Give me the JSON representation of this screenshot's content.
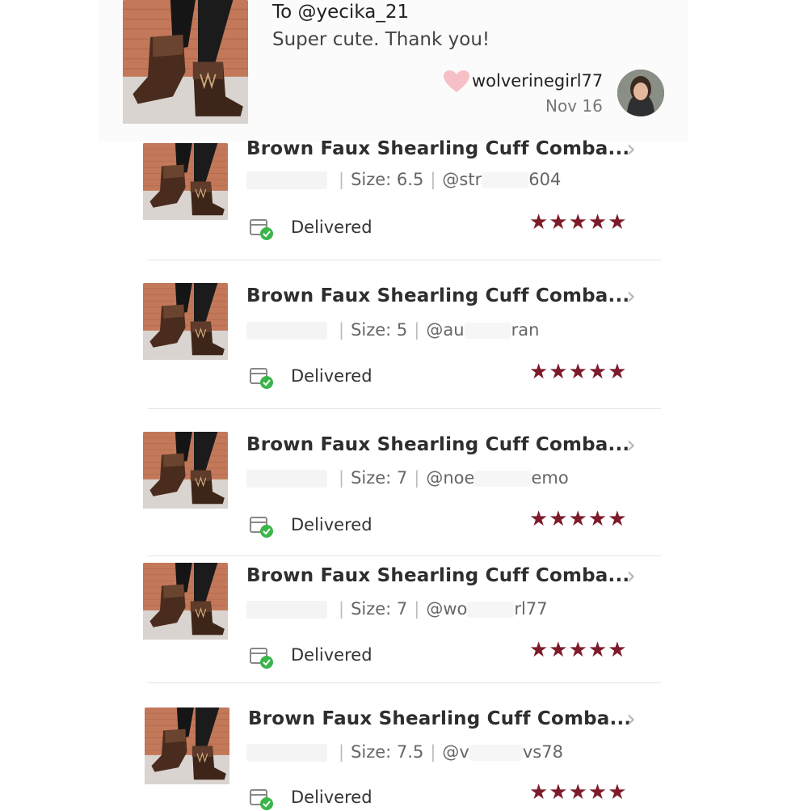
{
  "review": {
    "to": "To @yecika_21",
    "message": "Super cute. Thank you!",
    "reviewer": "wolverinegirl77",
    "date": "Nov 16"
  },
  "orders": [
    {
      "title": "Brown Faux Shearling Cuff Comba...",
      "size": "Size: 6.5",
      "handle_start": "@str",
      "handle_end": "604",
      "status": "Delivered",
      "stars": "★★★★★",
      "rating": 5
    },
    {
      "title": "Brown Faux Shearling Cuff Comba...",
      "size": "Size: 5",
      "handle_start": "@au",
      "handle_end": "ran",
      "status": "Delivered",
      "stars": "★★★★★",
      "rating": 5
    },
    {
      "title": "Brown Faux Shearling Cuff Comba...",
      "size": "Size: 7",
      "handle_start": "@noe",
      "handle_end": "emo",
      "status": "Delivered",
      "stars": "★★★★★",
      "rating": 5
    },
    {
      "title": "Brown Faux Shearling Cuff Comba...",
      "size": "Size: 7",
      "handle_start": "@wo",
      "handle_end": "rl77",
      "status": "Delivered",
      "stars": "★★★★★",
      "rating": 5
    },
    {
      "title": "Brown Faux Shearling Cuff Comba...",
      "size": "Size: 7.5",
      "handle_start": "@v",
      "handle_end": "vs78",
      "status": "Delivered",
      "stars": "★★★★★",
      "rating": 5
    }
  ],
  "icons": {
    "chevron": "›",
    "heart": "heart-icon",
    "delivered": "delivered-box-check-icon",
    "star": "star-icon"
  },
  "colors": {
    "star": "#7d1b2a",
    "heart": "#f7c0c6",
    "check": "#3bb54a"
  }
}
